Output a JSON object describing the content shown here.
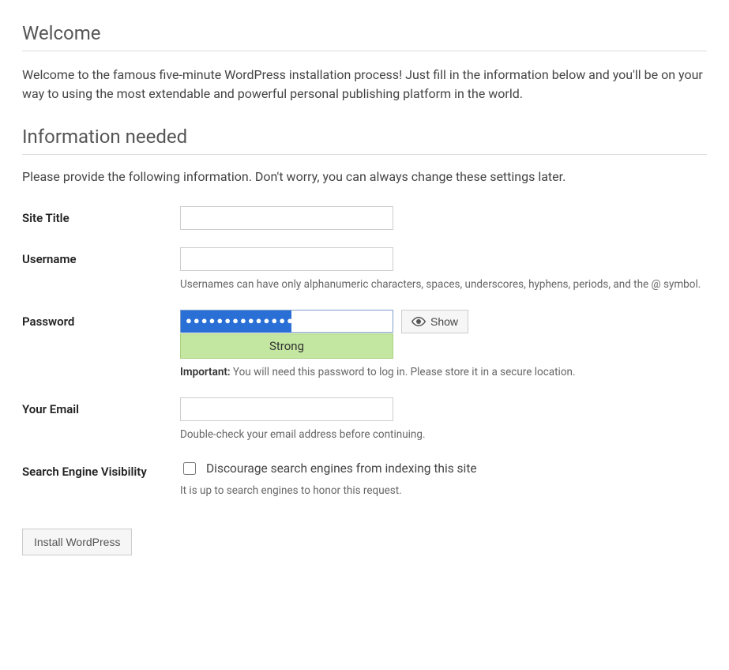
{
  "headings": {
    "welcome": "Welcome",
    "info_needed": "Information needed"
  },
  "intro_text": "Welcome to the famous five-minute WordPress installation process! Just fill in the information below and you'll be on your way to using the most extendable and powerful personal publishing platform in the world.",
  "sub_text": "Please provide the following information. Don't worry, you can always change these settings later.",
  "form": {
    "site_title": {
      "label": "Site Title",
      "value": ""
    },
    "username": {
      "label": "Username",
      "value": "",
      "hint": "Usernames can have only alphanumeric characters, spaces, underscores, hyphens, periods, and the @ symbol."
    },
    "password": {
      "label": "Password",
      "value": "●●●●●●●●●●●●●●",
      "show_label": "Show",
      "strength": "Strong",
      "hint_prefix": "Important:",
      "hint": " You will need this password to log in. Please store it in a secure location."
    },
    "email": {
      "label": "Your Email",
      "value": "",
      "hint": "Double-check your email address before continuing."
    },
    "visibility": {
      "label": "Search Engine Visibility",
      "checkbox_label": "Discourage search engines from indexing this site",
      "checked": false,
      "hint": "It is up to search engines to honor this request."
    }
  },
  "install_button": "Install WordPress"
}
